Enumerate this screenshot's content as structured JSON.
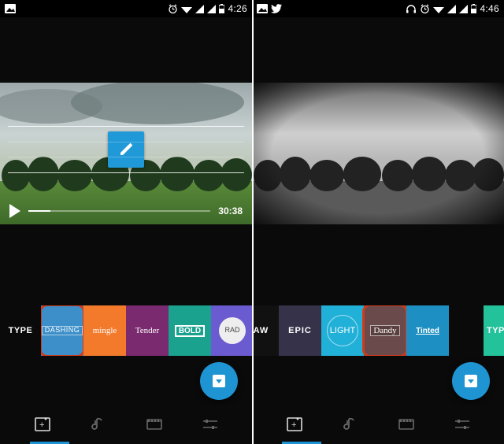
{
  "left": {
    "status": {
      "time": "4:26"
    },
    "playback": {
      "duration": "30:38",
      "progress_pct": 12
    },
    "type_label": "TYPE",
    "styles": [
      {
        "id": "dashing",
        "label": "DASHING",
        "color": "c-dashing",
        "lblcls": "lbl-dashing",
        "selected": true
      },
      {
        "id": "mingle",
        "label": "mingle",
        "color": "c-mingle",
        "lblcls": "lbl-mingle"
      },
      {
        "id": "tender",
        "label": "Tender",
        "color": "c-tender",
        "lblcls": "lbl-tender"
      },
      {
        "id": "bold",
        "label": "BOLD",
        "color": "c-bold",
        "lblcls": "lbl-bold"
      },
      {
        "id": "rad",
        "label": "RAD",
        "color": "c-rad",
        "lblcls": "lbl-rad"
      }
    ],
    "nav_active_index": 0
  },
  "right": {
    "status": {
      "time": "4:46"
    },
    "type_label_partial": "TYP",
    "styles": [
      {
        "id": "raw",
        "label": "RAW",
        "color": "c-raw",
        "lblcls": "lbl-raw"
      },
      {
        "id": "epic",
        "label": "EPIC",
        "color": "c-epic",
        "lblcls": "lbl-epic"
      },
      {
        "id": "light",
        "label": "LIGHT",
        "color": "c-light",
        "lblcls": "lbl-light"
      },
      {
        "id": "dandy",
        "label": "Dandy",
        "color": "c-dandy",
        "lblcls": "lbl-dandy",
        "selected": true
      },
      {
        "id": "tinted",
        "label": "Tinted",
        "color": "c-tinted",
        "lblcls": "lbl-tinted"
      }
    ],
    "nav_active_index": 0
  }
}
